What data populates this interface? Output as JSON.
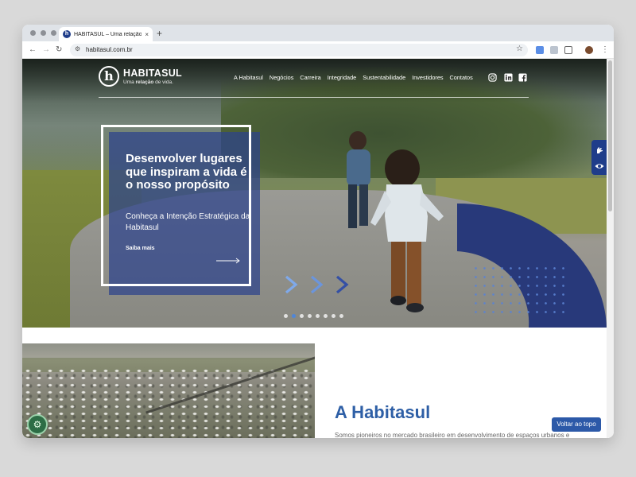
{
  "browser": {
    "tab_title": "HABITASUL – Uma relação de vida",
    "url": "habitasul.com.br",
    "new_tab": "+",
    "close_tab": "×"
  },
  "site": {
    "brand": "HABITASUL",
    "tagline_pre": "Uma ",
    "tagline_bold": "relação",
    "tagline_post": " de vida.",
    "logo_mark": "h",
    "colors": {
      "primary": "#1f3d8a",
      "accent": "#2e5fa6"
    }
  },
  "nav": {
    "items": [
      "A Habitasul",
      "Negócios",
      "Carreira",
      "Integridade",
      "Sustentabilidade",
      "Investidores",
      "Contatos"
    ],
    "social": [
      "instagram-icon",
      "linkedin-icon",
      "facebook-icon"
    ]
  },
  "hero": {
    "title": "Desenvolver lugares que inspiram a vida é o nosso propósito",
    "subtitle": "Conheça a Intenção Estratégica da Habitasul",
    "cta": "Saiba mais",
    "slide_count": 8,
    "active_slide": 1
  },
  "accessibility": {
    "icons": [
      "sign-language-icon",
      "eye-icon"
    ]
  },
  "about": {
    "title": "A Habitasul",
    "text": "Somos pioneiros no mercado brasileiro em desenvolvimento de espaços urbanos e"
  },
  "back_to_top": "Voltar ao topo"
}
